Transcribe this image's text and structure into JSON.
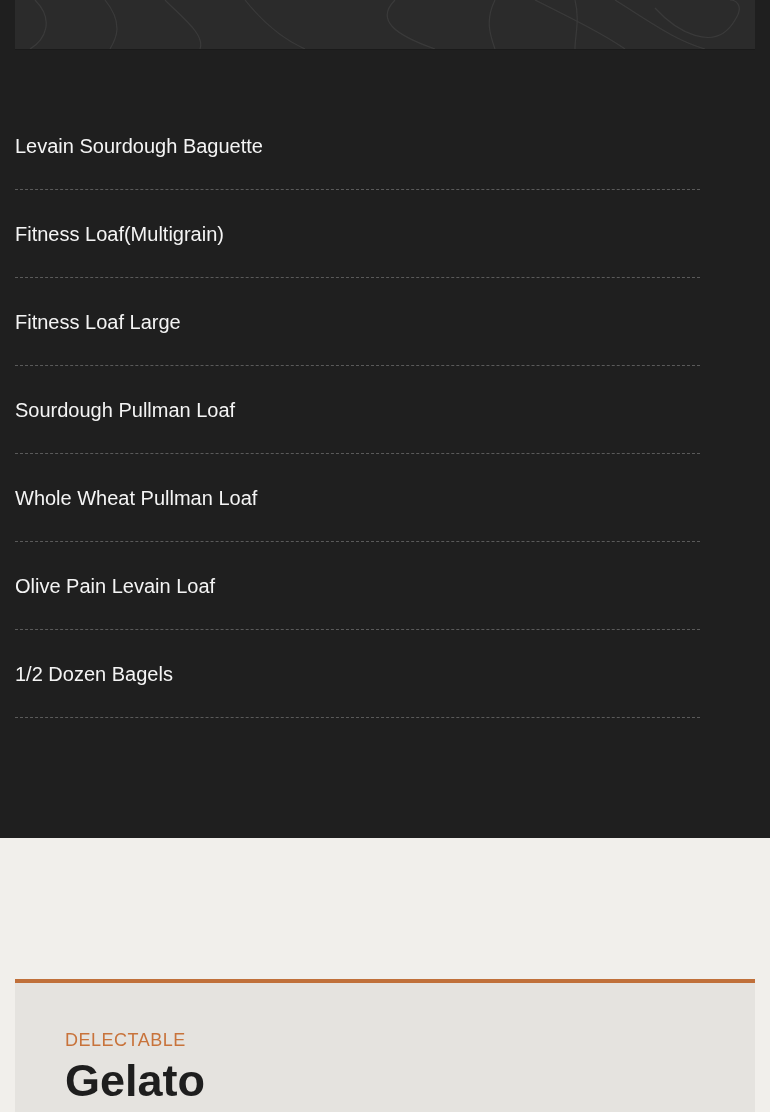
{
  "products": [
    {
      "name": "Levain Sourdough Baguette"
    },
    {
      "name": "Fitness Loaf(Multigrain)"
    },
    {
      "name": "Fitness Loaf Large"
    },
    {
      "name": "Sourdough Pullman Loaf"
    },
    {
      "name": "Whole Wheat Pullman Loaf"
    },
    {
      "name": "Olive Pain Levain Loaf"
    },
    {
      "name": "1/2 Dozen Bagels"
    }
  ],
  "feature_card": {
    "eyebrow": "DELECTABLE",
    "title": "Gelato"
  }
}
